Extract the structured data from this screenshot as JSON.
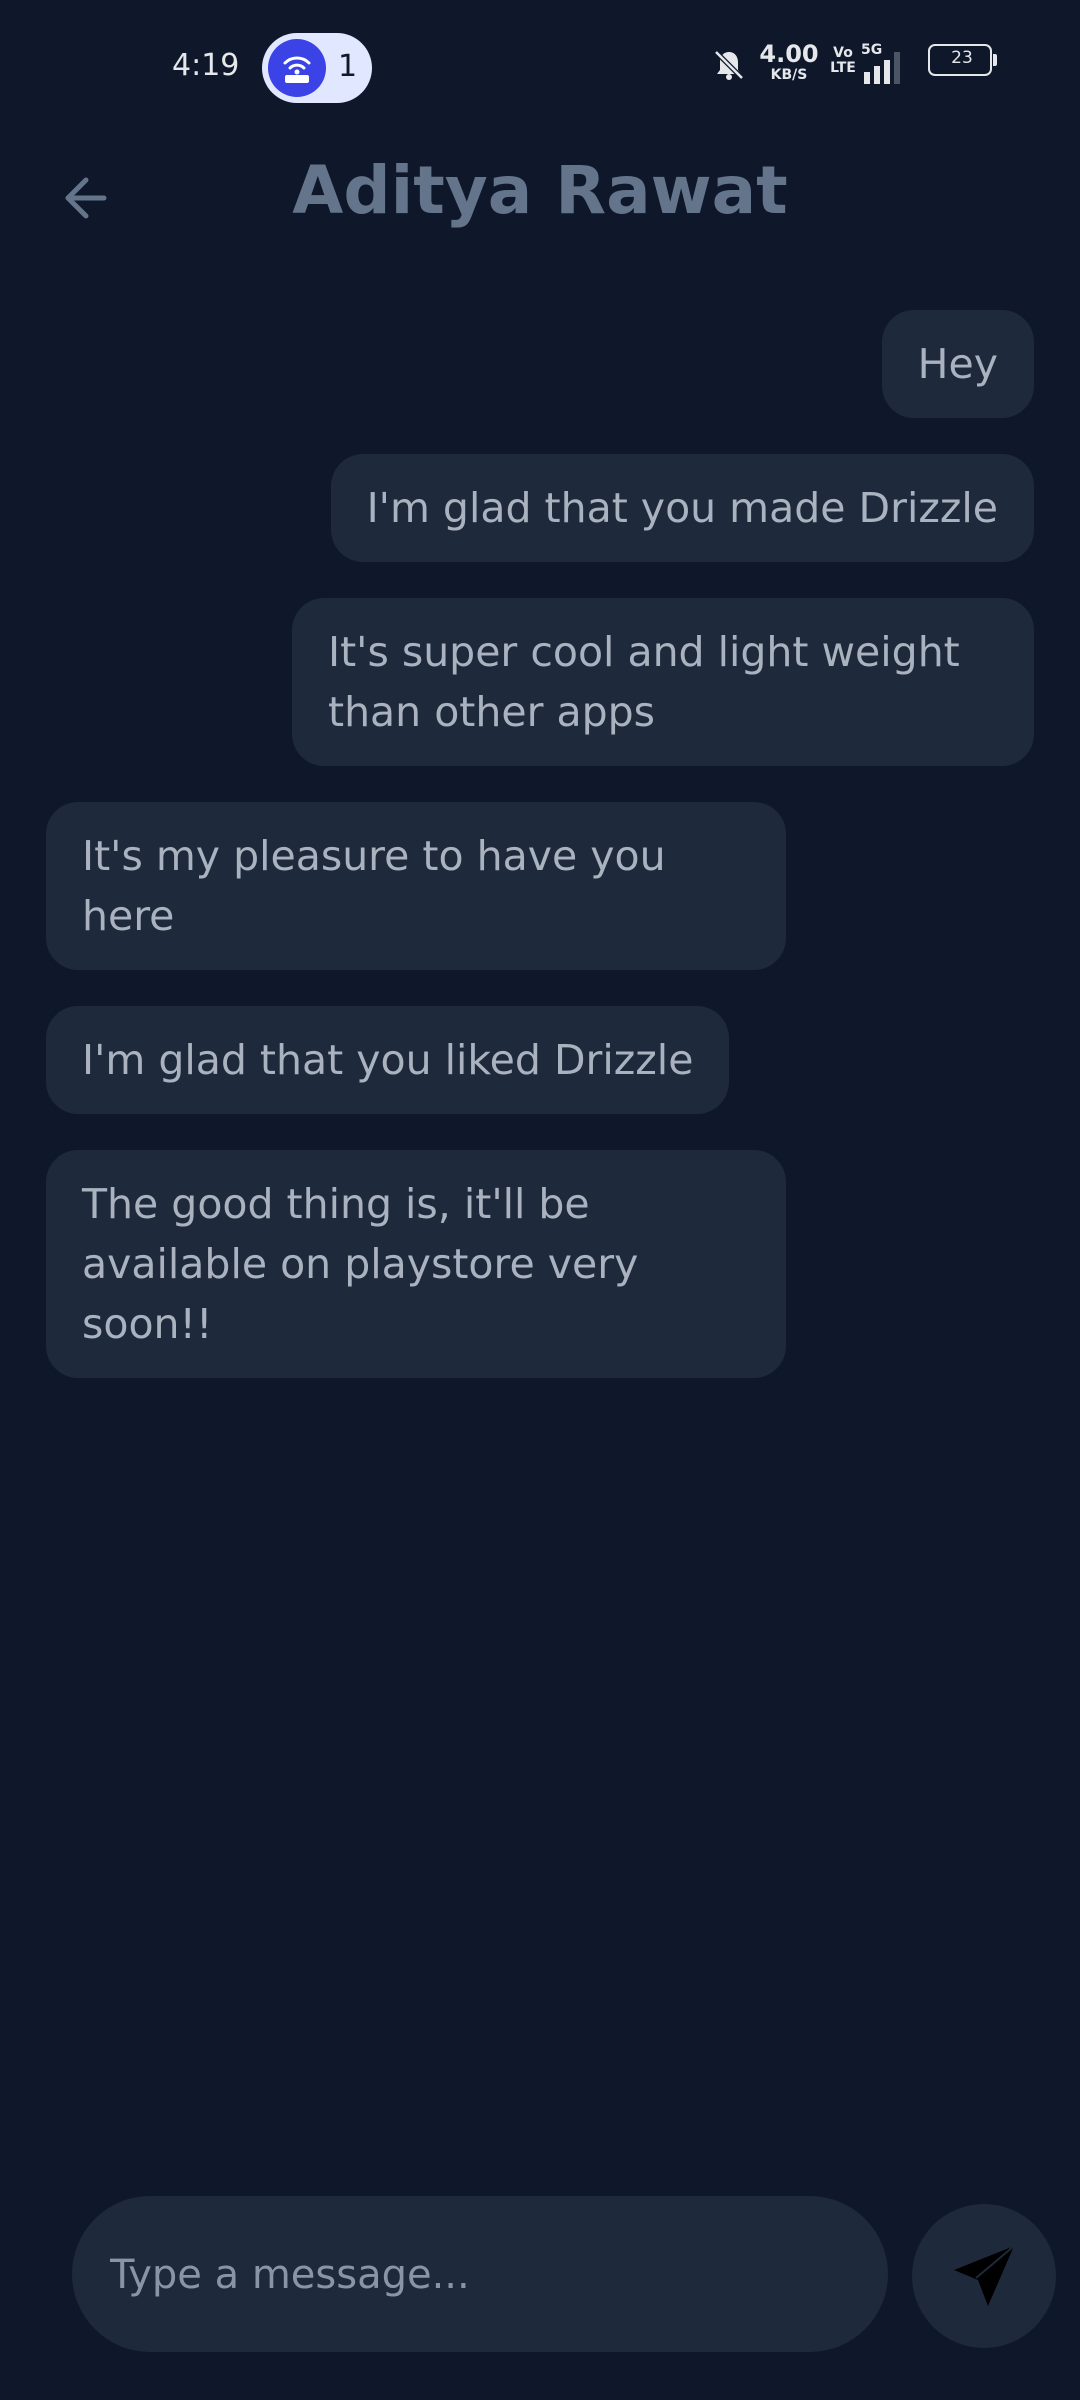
{
  "status_bar": {
    "time": "4:19",
    "hotspot_count": "1",
    "net_speed_value": "4.00",
    "net_speed_unit": "KB/S",
    "volte_top": "Vo",
    "volte_bottom": "LTE",
    "network_label": "5G",
    "battery_level": "23",
    "icons": [
      "hotspot-icon",
      "bell-off-icon",
      "signal-icon",
      "battery-icon"
    ]
  },
  "header": {
    "contact_name": "Aditya Rawat",
    "back_icon": "arrow-left-icon"
  },
  "messages": [
    {
      "direction": "sent",
      "text": "Hey"
    },
    {
      "direction": "sent",
      "text": "I'm glad that you made Drizzle"
    },
    {
      "direction": "sent",
      "text": "It's super cool and light weight\nthan other apps"
    },
    {
      "direction": "received",
      "text": "It's my pleasure to have you\nhere"
    },
    {
      "direction": "received",
      "text": "I'm glad that you liked Drizzle"
    },
    {
      "direction": "received",
      "text": "The good thing is, it'll be\navailable on playstore very\nsoon!!"
    }
  ],
  "composer": {
    "placeholder": "Type a message...",
    "value": "",
    "send_icon": "send-icon"
  },
  "colors": {
    "background": "#0f172a",
    "bubble": "#1e293b",
    "bubble_text": "#aab2bf",
    "title": "#64748b",
    "hotspot_accent": "#3b42e6"
  }
}
